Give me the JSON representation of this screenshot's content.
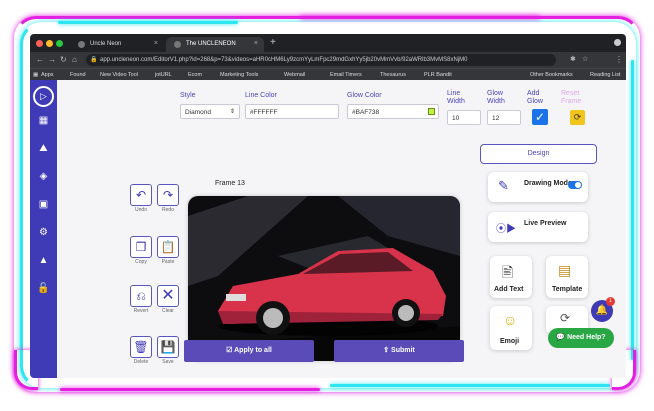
{
  "browser": {
    "tabs": [
      {
        "title": "Uncle Neon"
      },
      {
        "title": "The UNCLENEON"
      }
    ],
    "new_tab_icon": "plus-icon",
    "url": "app.uncleneon.com/EditorV1.php?id=268&p=73&videos=aHR0cHM6Ly9zcmYyLmFpc29mdGxhYy5jb20vMmVvb/92aWRlb3MvMS8xNjM0",
    "bookmarks": [
      "Apps",
      "Found",
      "New Video Tool",
      "jotURL",
      "Ecom",
      "Marketing Tools",
      "Webmail",
      "Email Timers",
      "Thesaurus",
      "PLR Bandit"
    ],
    "other_bookmarks": "Other Bookmarks",
    "reading_list": "Reading List"
  },
  "toolbar": {
    "style_label": "Style",
    "style_value": "Diamond",
    "line_color_label": "Line Color",
    "line_color_value": "#FFFFFF",
    "glow_color_label": "Glow Color",
    "glow_color_value": "#BAF738",
    "line_width_label": "Line Width",
    "line_width_value": "10",
    "glow_width_label": "Glow Width",
    "glow_width_value": "12",
    "add_glow_label": "Add Glow",
    "add_glow_checked": true,
    "reset_frame_label": "Reset Frame"
  },
  "editor": {
    "frame_title": "Frame 13",
    "tools": [
      {
        "name": "undo",
        "label": "Undo"
      },
      {
        "name": "redo",
        "label": "Redo"
      },
      {
        "name": "copy",
        "label": "Copy"
      },
      {
        "name": "paste",
        "label": "Paste"
      },
      {
        "name": "revert",
        "label": "Revert"
      },
      {
        "name": "clear",
        "label": "Clear"
      },
      {
        "name": "delete",
        "label": "Delete"
      },
      {
        "name": "save",
        "label": "Save"
      }
    ],
    "apply_label": "Apply to all",
    "submit_label": "Submit"
  },
  "right_panel": {
    "design_tab": "Design",
    "drawing_mode_label": "Drawing Mode",
    "drawing_mode_on": true,
    "live_preview_label": "Live Preview",
    "add_text_label": "Add Text",
    "template_label": "Template",
    "emoji_label": "Emoji",
    "notification_count": "1",
    "help_label": "Need Help?"
  },
  "colors": {
    "primary": "#3f3ab5",
    "button": "#5a4bb8",
    "neon_cyan": "#2ee6f0",
    "neon_magenta": "#e51ee0",
    "checkbox": "#1a73e8",
    "reset_yellow": "#f2c51c",
    "help_green": "#2aa745",
    "car_red": "#d8334a"
  }
}
